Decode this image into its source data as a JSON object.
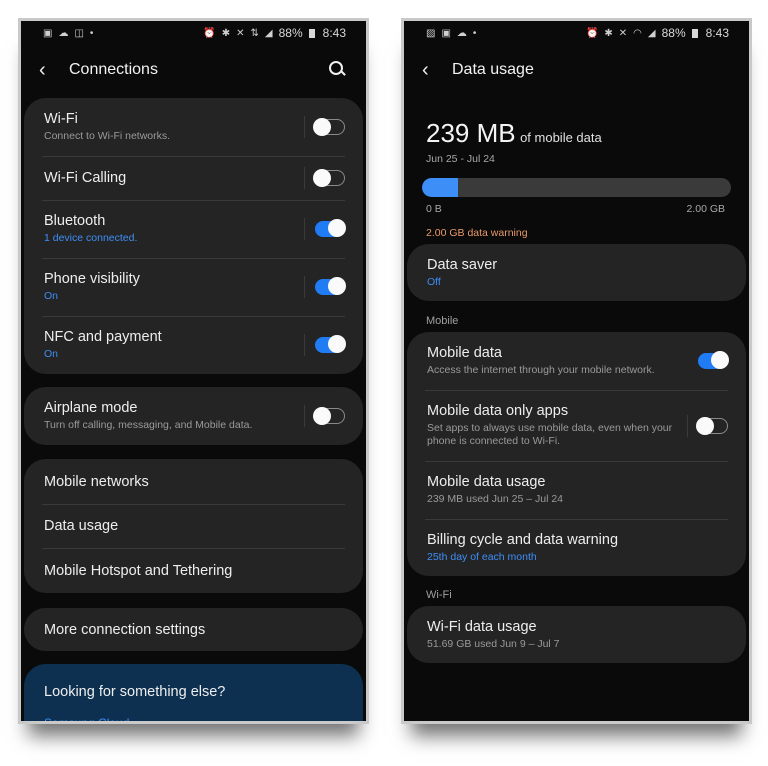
{
  "left": {
    "status": {
      "time": "8:43",
      "battery": "88%",
      "left_icons": [
        "tablet-icon",
        "cloud-icon",
        "nfc-icon",
        "dot"
      ],
      "right_icons": [
        "alarm-icon",
        "bluetooth-icon",
        "mute-icon",
        "lte-icon",
        "signal-icon"
      ]
    },
    "title": "Connections",
    "group1": [
      {
        "title": "Wi-Fi",
        "sub": "Connect to Wi-Fi networks.",
        "sub_blue": false,
        "toggle": false
      },
      {
        "title": "Wi-Fi Calling",
        "sub": "",
        "sub_blue": false,
        "toggle": false
      },
      {
        "title": "Bluetooth",
        "sub": "1 device connected.",
        "sub_blue": true,
        "toggle": true
      },
      {
        "title": "Phone visibility",
        "sub": "On",
        "sub_blue": true,
        "toggle": true
      },
      {
        "title": "NFC and payment",
        "sub": "On",
        "sub_blue": true,
        "toggle": true
      }
    ],
    "airplane": {
      "title": "Airplane mode",
      "sub": "Turn off calling, messaging, and Mobile data.",
      "toggle": false
    },
    "group3": [
      "Mobile networks",
      "Data usage",
      "Mobile Hotspot and Tethering"
    ],
    "more": "More connection settings",
    "promo": {
      "title": "Looking for something else?",
      "link": "Samsung Cloud"
    }
  },
  "right": {
    "status": {
      "time": "8:43",
      "battery": "88%",
      "left_icons": [
        "image-icon",
        "tablet-icon",
        "cloud-icon",
        "dot"
      ],
      "right_icons": [
        "alarm-icon",
        "bluetooth-icon",
        "mute-icon",
        "wifi-icon",
        "signal-icon"
      ]
    },
    "title": "Data usage",
    "usage_amount": "239 MB",
    "usage_suffix": "of mobile data",
    "period": "Jun 25 - Jul 24",
    "bar_fraction": 0.117,
    "bar_min": "0 B",
    "bar_max": "2.00 GB",
    "warning": "2.00 GB data warning",
    "data_saver": {
      "title": "Data saver",
      "sub": "Off"
    },
    "mobile_section": "Mobile",
    "mobile_items": [
      {
        "title": "Mobile data",
        "sub": "Access the internet through your mobile network.",
        "sub_blue": false,
        "toggle": true
      },
      {
        "title": "Mobile data only apps",
        "sub": "Set apps to always use mobile data, even when your phone is connected to Wi-Fi.",
        "sub_blue": false,
        "toggle": false
      },
      {
        "title": "Mobile data usage",
        "sub": "239 MB used Jun 25 – Jul 24",
        "sub_blue": false
      },
      {
        "title": "Billing cycle and data warning",
        "sub": "25th day of each month",
        "sub_blue": true
      }
    ],
    "wifi_section": "Wi-Fi",
    "wifi_item": {
      "title": "Wi-Fi data usage",
      "sub": "51.69 GB used Jun 9 – Jul 7"
    }
  },
  "colors": {
    "accent": "#1f7cf3",
    "link": "#3e8ef7",
    "warning": "#e89a6a",
    "card": "#242424",
    "background": "#0a0a0a",
    "promo": "#0d3050"
  }
}
